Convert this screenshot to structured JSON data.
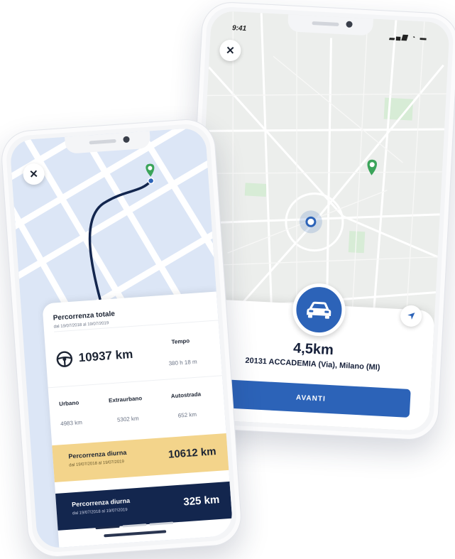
{
  "colors": {
    "accent": "#2c63b8",
    "navy": "#13264e",
    "yellow": "#f3d48b",
    "pin": "#3ba45a"
  },
  "map_phone": {
    "status_time": "9:41",
    "close_icon": "close-icon",
    "navigate_icon": "navigation-arrow-icon",
    "distance": "4,5km",
    "address": "20131 ACCADEMIA (Via), Milano (MI)",
    "button_label": "AVANTI"
  },
  "stats_phone": {
    "close_icon": "close-icon",
    "total": {
      "title": "Percorrenza totale",
      "range": "dal 19/07/2018 al 19/07/2019",
      "km": "10937 km",
      "time_label": "Tempo",
      "time_value": "380 h 18 m"
    },
    "breakdown": [
      {
        "label": "Urbano",
        "value": "4983 km"
      },
      {
        "label": "Extraurbano",
        "value": "5302 km"
      },
      {
        "label": "Autostrada",
        "value": "652 km"
      }
    ],
    "day_band": {
      "title": "Percorrenza diurna",
      "range": "dal 19/07/2018 al 19/07/2019",
      "value": "10612 km"
    },
    "night_band": {
      "title": "Percorrenza diurna",
      "range": "dal 19/07/2018 al 19/07/2019",
      "value": "325 km"
    }
  }
}
